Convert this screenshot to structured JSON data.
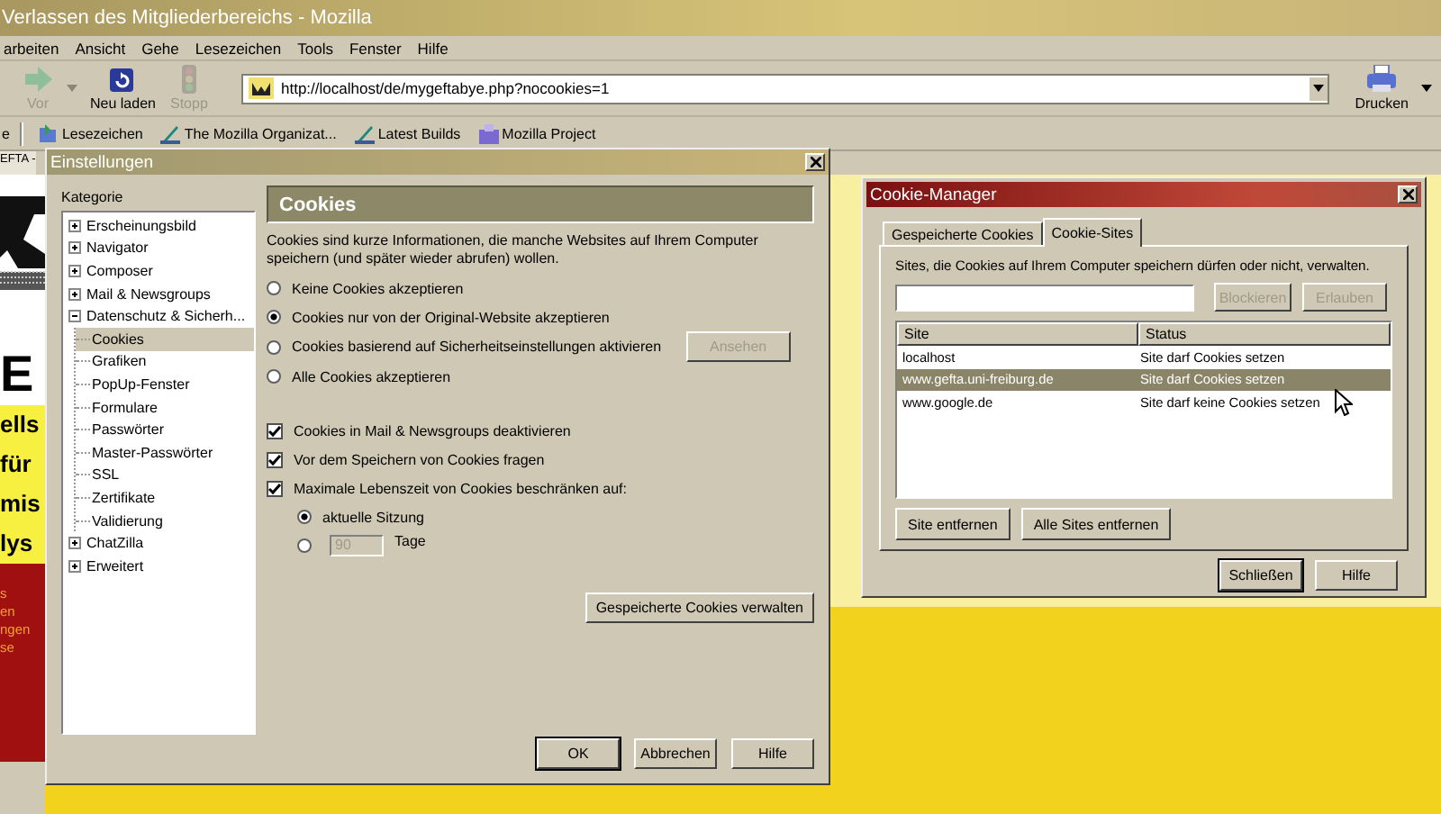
{
  "browser": {
    "title": "Verlassen des Mitgliederbereichs - Mozilla",
    "menu": [
      "arbeiten",
      "Ansicht",
      "Gehe",
      "Lesezeichen",
      "Tools",
      "Fenster",
      "Hilfe"
    ],
    "toolbar": [
      {
        "kind": "forward",
        "label": "Vor",
        "disabled": true
      },
      {
        "kind": "reload",
        "label": "Neu laden",
        "disabled": false
      },
      {
        "kind": "stop",
        "label": "Stopp",
        "disabled": true
      }
    ],
    "address": "http://localhost/de/mygeftabye.php?nocookies=1",
    "print": "Drucken",
    "bookmarks_cut": "e",
    "bookmarks": [
      {
        "kind": "folder",
        "label": "Lesezeichen"
      },
      {
        "kind": "link",
        "label": "The Mozilla Organizat..."
      },
      {
        "kind": "link",
        "label": "Latest Builds"
      },
      {
        "kind": "project",
        "label": "Mozilla Project"
      }
    ],
    "tab": "EFTA -",
    "page": {
      "heading": "E",
      "lines": [
        "ells",
        "für",
        "mis",
        "lys"
      ],
      "links": [
        "s",
        "en",
        "ngen",
        "se"
      ]
    }
  },
  "preferences": {
    "title": "Einstellungen",
    "category_label": "Kategorie",
    "categories": [
      {
        "label": "Erscheinungsbild",
        "expanded": false,
        "selected": false
      },
      {
        "label": "Navigator",
        "expanded": false,
        "selected": false
      },
      {
        "label": "Composer",
        "expanded": false,
        "selected": false
      },
      {
        "label": "Mail & Newsgroups",
        "expanded": false,
        "selected": false
      },
      {
        "label": "Datenschutz & Sicherh...",
        "expanded": true,
        "selected": false,
        "children": [
          {
            "label": "Cookies",
            "selected": true
          },
          {
            "label": "Grafiken",
            "selected": false
          },
          {
            "label": "PopUp-Fenster",
            "selected": false
          },
          {
            "label": "Formulare",
            "selected": false
          },
          {
            "label": "Passwörter",
            "selected": false
          },
          {
            "label": "Master-Passwörter",
            "selected": false
          },
          {
            "label": "SSL",
            "selected": false
          },
          {
            "label": "Zertifikate",
            "selected": false
          },
          {
            "label": "Validierung",
            "selected": false
          }
        ]
      },
      {
        "label": "ChatZilla",
        "expanded": false,
        "selected": false
      },
      {
        "label": "Erweitert",
        "expanded": false,
        "selected": false
      }
    ],
    "panel_title": "Cookies",
    "description": "Cookies sind kurze Informationen, die manche Websites auf Ihrem Computer speichern (und später wieder abrufen) wollen.",
    "policies": [
      {
        "label": "Keine Cookies akzeptieren",
        "selected": false
      },
      {
        "label": "Cookies nur von der Original-Website akzeptieren",
        "selected": true
      },
      {
        "label": "Cookies basierend auf Sicherheitseinstellungen aktivieren",
        "selected": false,
        "button": {
          "label": "Ansehen",
          "disabled": true
        }
      },
      {
        "label": "Alle Cookies akzeptieren",
        "selected": false
      }
    ],
    "options": [
      {
        "label": "Cookies in Mail & Newsgroups deaktivieren",
        "checked": true
      },
      {
        "label": "Vor dem Speichern von Cookies fragen",
        "checked": true
      },
      {
        "label": "Maximale Lebenszeit von Cookies beschränken auf:",
        "checked": true
      }
    ],
    "lifetime": [
      {
        "kind": "session",
        "label": "aktuelle Sitzung",
        "selected": true
      },
      {
        "kind": "days",
        "value": "90",
        "unit": "Tage",
        "selected": false,
        "disabled": true
      }
    ],
    "manage_button": "Gespeicherte Cookies verwalten",
    "buttons": [
      {
        "label": "OK",
        "default": true
      },
      {
        "label": "Abbrechen",
        "default": false
      },
      {
        "label": "Hilfe",
        "default": false
      }
    ]
  },
  "cookie_manager": {
    "title": "Cookie-Manager",
    "tabs": [
      {
        "label": "Gespeicherte Cookies",
        "selected": false
      },
      {
        "label": "Cookie-Sites",
        "selected": true
      }
    ],
    "description": "Sites, die Cookies auf Ihrem Computer speichern dürfen oder nicht, verwalten.",
    "filter_buttons": [
      {
        "label": "Blockieren",
        "disabled": true
      },
      {
        "label": "Erlauben",
        "disabled": true
      }
    ],
    "columns": [
      "Site",
      "Status"
    ],
    "rows": [
      {
        "site": "localhost",
        "status": "Site darf Cookies setzen",
        "selected": false
      },
      {
        "site": "www.gefta.uni-freiburg.de",
        "status": "Site darf Cookies setzen",
        "selected": true
      },
      {
        "site": "www.google.de",
        "status": "Site darf keine Cookies setzen",
        "selected": false
      }
    ],
    "actions": [
      "Site entfernen",
      "Alle Sites entfernen"
    ],
    "buttons": [
      {
        "label": "Schließen",
        "default": true
      },
      {
        "label": "Hilfe",
        "default": false
      }
    ]
  }
}
